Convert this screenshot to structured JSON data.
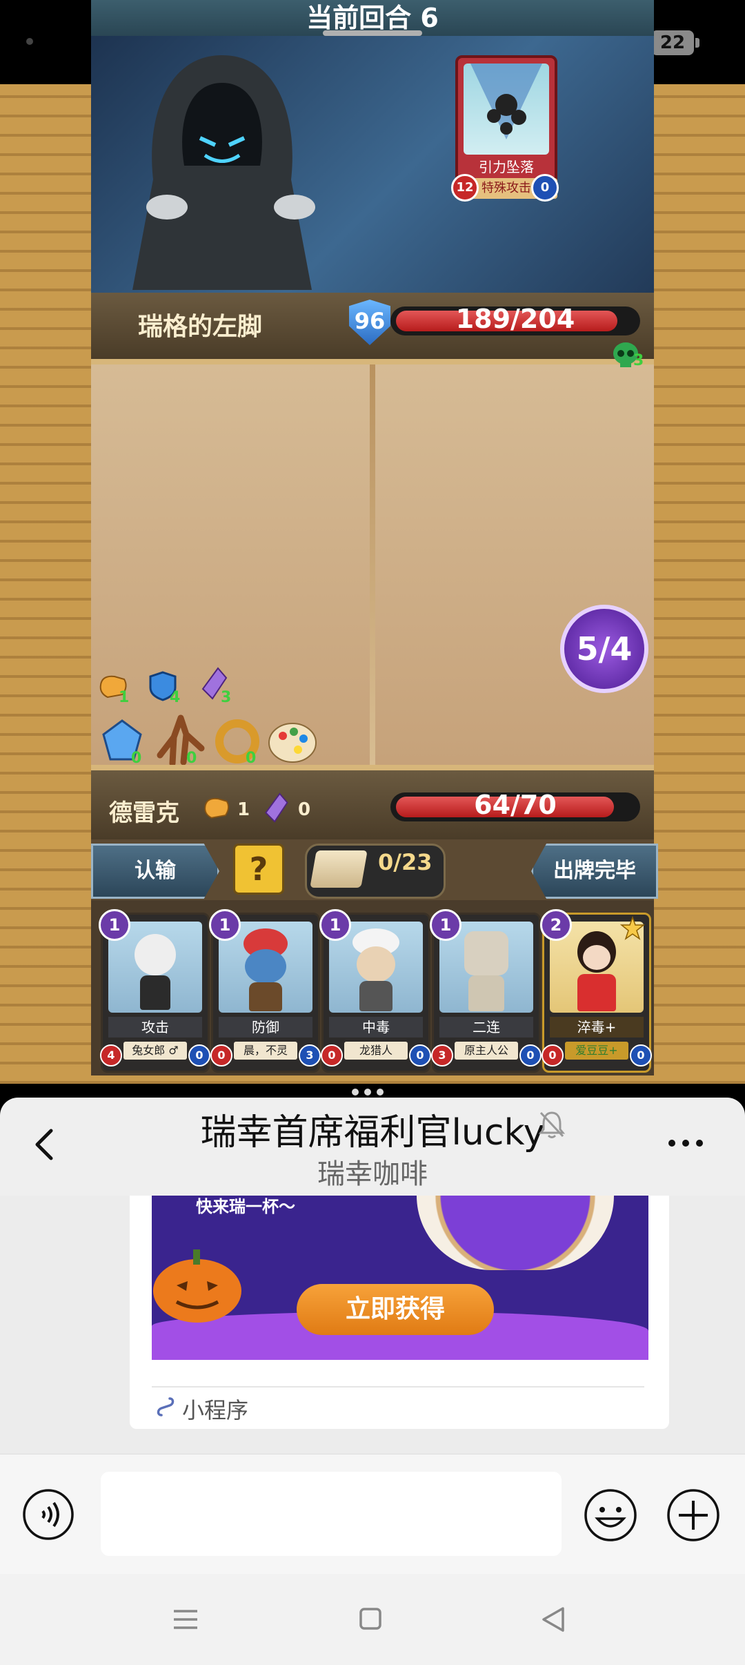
{
  "status_bar": {
    "battery": "22"
  },
  "game": {
    "round_label": "当前回合 6",
    "enemy": {
      "name": "瑞格的左脚",
      "shield": "96",
      "hp_text": "189/204",
      "hp_current": 189,
      "hp_max": 204,
      "card": {
        "name": "引力坠落",
        "type": "特殊攻击",
        "red": "12",
        "blue": "0"
      }
    },
    "skull_count": "3",
    "resources": [
      {
        "icon": "fist-icon",
        "count": "1"
      },
      {
        "icon": "shield-icon",
        "count": "4"
      },
      {
        "icon": "crystal-icon",
        "count": "3"
      }
    ],
    "items": [
      {
        "icon": "blue-gem-icon",
        "count": "0"
      },
      {
        "icon": "root-icon",
        "count": "0"
      },
      {
        "icon": "ring-icon",
        "count": "0"
      },
      {
        "icon": "palette-icon",
        "count": ""
      }
    ],
    "energy": "5/4",
    "player": {
      "name": "德雷克",
      "fist": "1",
      "crystal": "0",
      "hp_text": "64/70",
      "hp_current": 64,
      "hp_max": 70
    },
    "buttons": {
      "surrender": "认输",
      "help": "?",
      "deck": "0/23",
      "end_turn": "出牌完毕"
    },
    "hand": [
      {
        "cost": "1",
        "name": "攻击",
        "owner": "兔女郎 ♂",
        "red": "4",
        "blue": "0"
      },
      {
        "cost": "1",
        "name": "防御",
        "owner": "晨，不灵",
        "red": "0",
        "blue": "3"
      },
      {
        "cost": "1",
        "name": "中毒",
        "owner": "龙猎人",
        "red": "0",
        "blue": "0"
      },
      {
        "cost": "1",
        "name": "二连",
        "owner": "原主人公",
        "red": "3",
        "blue": "0"
      },
      {
        "cost": "2",
        "name": "淬毒+",
        "owner": "爱豆豆+",
        "red": "0",
        "blue": "0"
      }
    ]
  },
  "chat": {
    "title": "瑞幸首席福利官lucky",
    "subtitle": "瑞幸咖啡",
    "promo_text": "快来瑞一杯～",
    "promo_button": "立即获得",
    "mini_program_label": "小程序",
    "input_placeholder": ""
  },
  "colors": {
    "accent_purple": "#3a248e",
    "promo_orange": "#e07b14",
    "hp_red": "#c62828"
  }
}
